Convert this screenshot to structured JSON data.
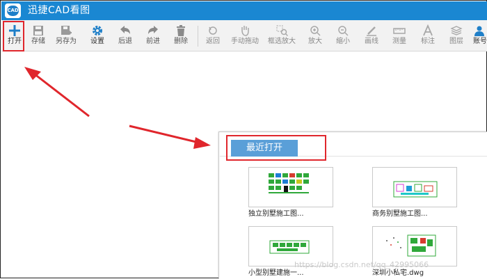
{
  "app": {
    "title": "迅捷CAD看图",
    "logo_text": "CAD",
    "title_bar_color": "#1a87d2"
  },
  "toolbar": {
    "items": [
      {
        "label": "打开",
        "icon": "plus-icon"
      },
      {
        "label": "存储",
        "icon": "save-icon"
      },
      {
        "label": "另存为",
        "icon": "save-as-icon"
      },
      {
        "label": "设置",
        "icon": "gear-icon"
      },
      {
        "label": "后退",
        "icon": "undo-icon"
      },
      {
        "label": "前进",
        "icon": "redo-icon"
      },
      {
        "label": "删除",
        "icon": "trash-icon"
      },
      {
        "label": "返回",
        "icon": "return-icon"
      },
      {
        "label": "手动拖动",
        "icon": "hand-icon"
      },
      {
        "label": "框选放大",
        "icon": "box-zoom-icon"
      },
      {
        "label": "放大",
        "icon": "zoom-in-icon"
      },
      {
        "label": "缩小",
        "icon": "zoom-out-icon"
      },
      {
        "label": "画线",
        "icon": "pen-icon"
      },
      {
        "label": "测量",
        "icon": "ruler-icon"
      },
      {
        "label": "标注",
        "icon": "text-a-icon"
      },
      {
        "label": "图层",
        "icon": "layers-icon"
      },
      {
        "label": "账号",
        "icon": "user-icon"
      }
    ]
  },
  "recent": {
    "tab_label": "最近打开",
    "files": [
      {
        "name": "独立别墅施工图..."
      },
      {
        "name": "商务别墅施工图..."
      },
      {
        "name": "小型别墅建施一..."
      },
      {
        "name": "深圳小私宅.dwg"
      }
    ]
  },
  "annotation_color": "#e0262c",
  "watermark": "https://blog.csdn.net/qq_42995066"
}
